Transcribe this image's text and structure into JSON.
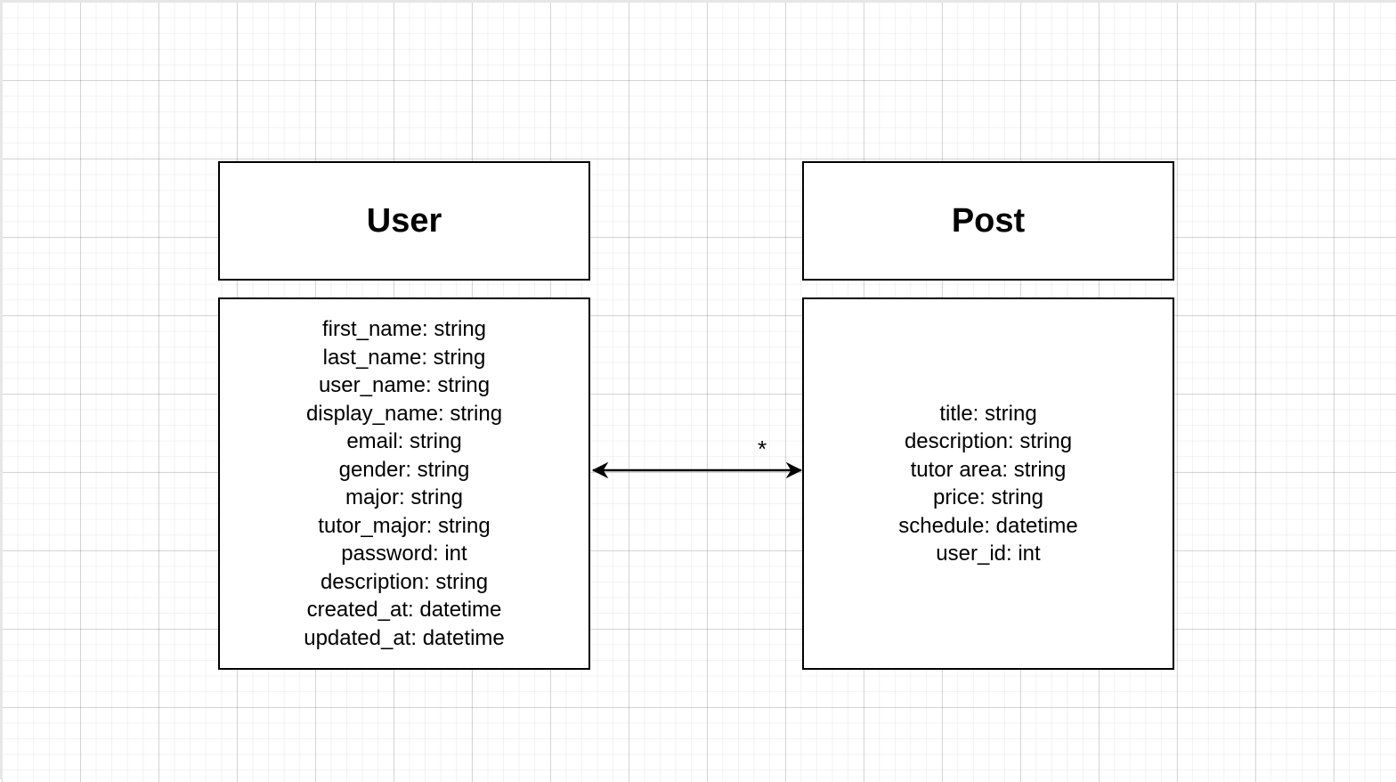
{
  "diagram": {
    "classes": [
      {
        "id": "user",
        "name": "User",
        "attributes": [
          "first_name: string",
          "last_name: string",
          "user_name: string",
          "display_name: string",
          "email: string",
          "gender: string",
          "major: string",
          "tutor_major: string",
          "password: int",
          "description: string",
          "created_at: datetime",
          "updated_at: datetime"
        ]
      },
      {
        "id": "post",
        "name": "Post",
        "attributes": [
          "title: string",
          "description: string",
          "tutor area: string",
          "price: string",
          "schedule: datetime",
          "user_id: int"
        ]
      }
    ],
    "association": {
      "from": "User",
      "to": "Post",
      "arrows": "both",
      "multiplicity_to": "*"
    }
  }
}
